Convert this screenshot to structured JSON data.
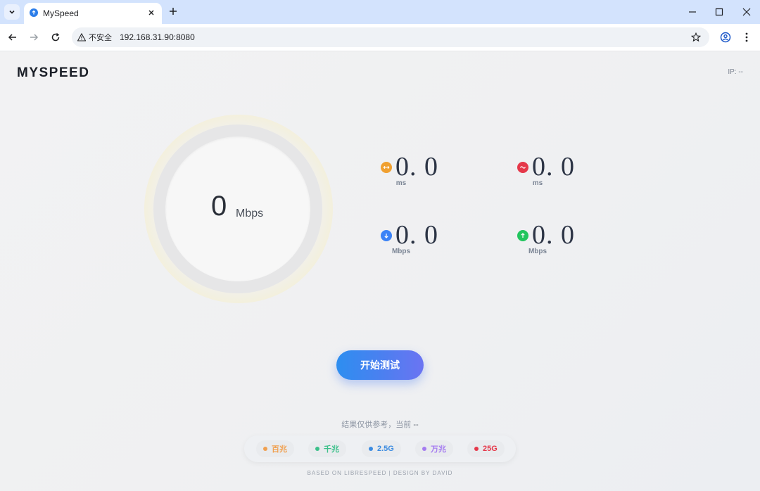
{
  "browser": {
    "tab_title": "MySpeed",
    "security_label": "不安全",
    "url": "192.168.31.90:8080"
  },
  "app": {
    "logo": "MYSPEED",
    "ip_label": "IP: --"
  },
  "gauge": {
    "value": "0",
    "unit": "Mbps"
  },
  "metrics": [
    {
      "icon": "ping-icon",
      "color": "#f0a030",
      "value": "0. 0",
      "unit": "ms"
    },
    {
      "icon": "jitter-icon",
      "color": "#e5384a",
      "value": "0. 0",
      "unit": "ms"
    },
    {
      "icon": "download-icon",
      "color": "#3b82f6",
      "value": "0. 0",
      "unit": "Mbps"
    },
    {
      "icon": "upload-icon",
      "color": "#22c55e",
      "value": "0. 0",
      "unit": "Mbps"
    }
  ],
  "start_button": "开始测试",
  "note": {
    "text": "结果仅供参考，当前",
    "current": "--"
  },
  "levels": [
    {
      "label": "百兆",
      "color": "#f0a050"
    },
    {
      "label": "千兆",
      "color": "#3cc08a"
    },
    {
      "label": "2.5G",
      "color": "#3b8be0"
    },
    {
      "label": "万兆",
      "color": "#a57cf0"
    },
    {
      "label": "25G",
      "color": "#e5384a"
    }
  ],
  "footer": "BASED ON LIBRESPEED | DESIGN BY DAVID"
}
